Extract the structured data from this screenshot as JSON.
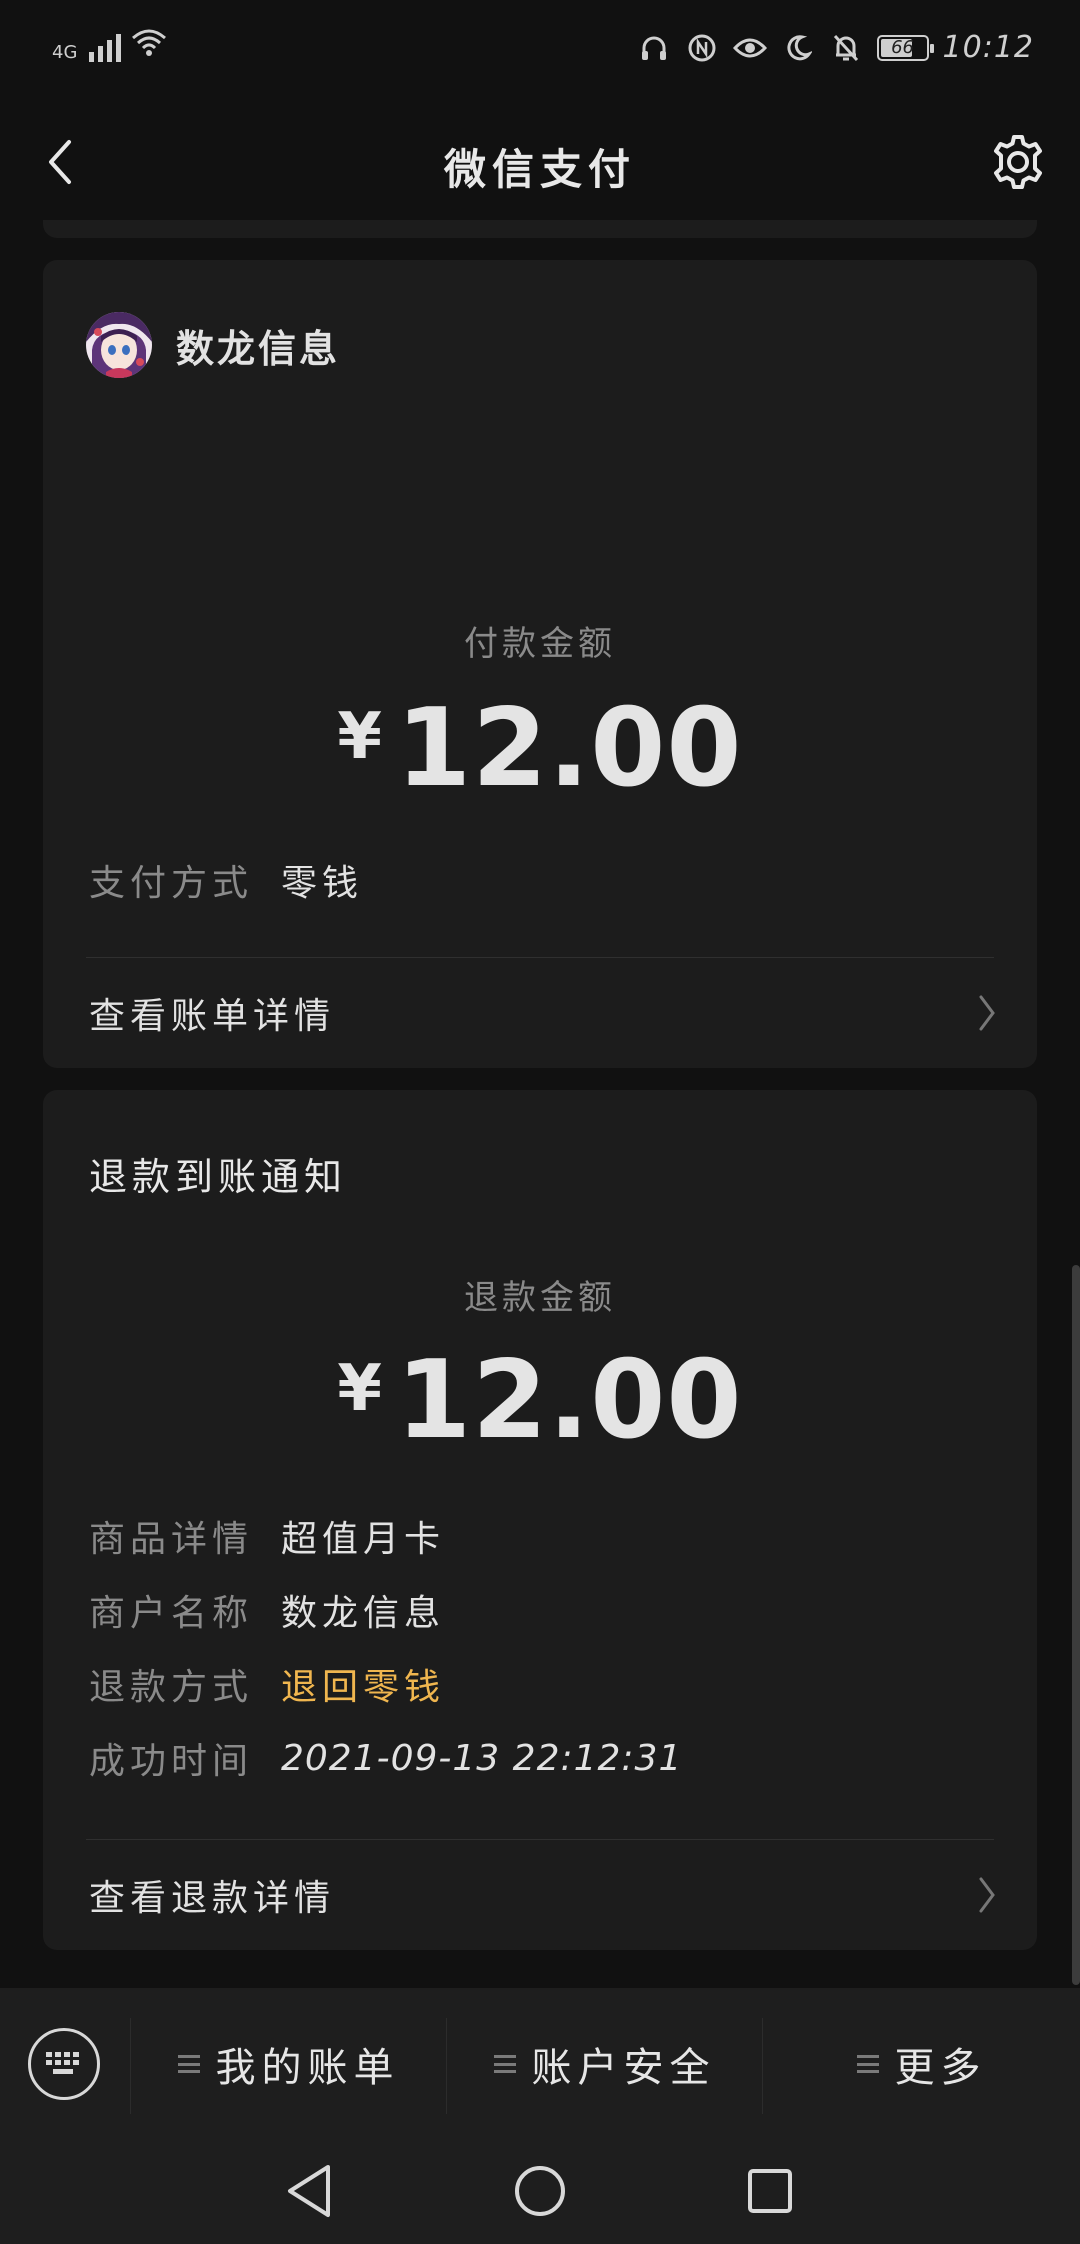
{
  "status_bar": {
    "network": "4G",
    "battery": "66",
    "time": "10:12"
  },
  "header": {
    "title": "微信支付"
  },
  "payment_card": {
    "merchant_name": "数龙信息",
    "amount_label": "付款金额",
    "currency": "¥",
    "amount": "12.00",
    "method_label": "支付方式",
    "method_value": "零钱",
    "link_text": "查看账单详情"
  },
  "refund_card": {
    "title": "退款到账通知",
    "amount_label": "退款金额",
    "currency": "¥",
    "amount": "12.00",
    "rows": [
      {
        "label": "商品详情",
        "value": "超值月卡"
      },
      {
        "label": "商户名称",
        "value": "数龙信息"
      },
      {
        "label": "退款方式",
        "value": "退回零钱"
      },
      {
        "label": "成功时间",
        "value": "2021-09-13 22:12:31"
      }
    ],
    "link_text": "查看退款详情"
  },
  "bottom_menu": {
    "items": [
      {
        "label": "我的账单"
      },
      {
        "label": "账户安全"
      },
      {
        "label": "更多"
      }
    ]
  },
  "colors": {
    "accent": "#f0b64f",
    "background": "#111111",
    "card": "#1c1c1c"
  }
}
